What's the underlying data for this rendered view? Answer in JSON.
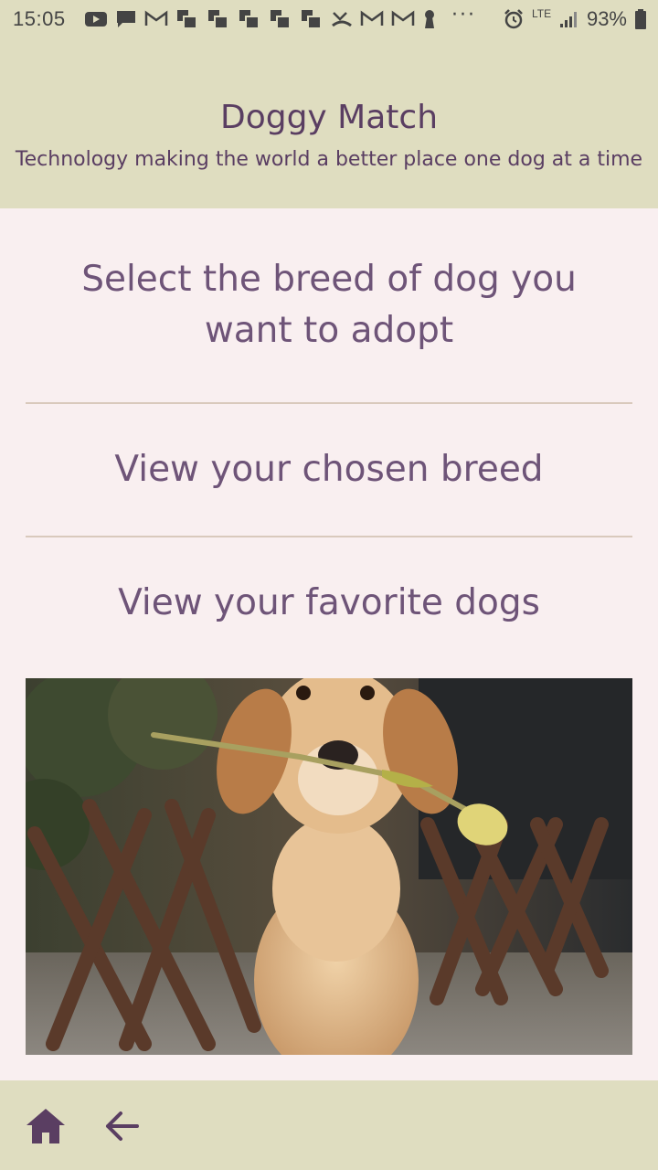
{
  "status_bar": {
    "time": "15:05",
    "network": "LTE",
    "battery": "93%"
  },
  "header": {
    "title": "Doggy Match",
    "subtitle": "Technology making the world a better place one dog at a time"
  },
  "menu": {
    "items": [
      {
        "label": "Select the breed of dog you want to adopt"
      },
      {
        "label": "View your chosen breed"
      },
      {
        "label": "View your favorite dogs"
      }
    ]
  },
  "nav": {
    "home_icon": "home-icon",
    "back_icon": "arrow-left-icon"
  },
  "colors": {
    "header_bg": "#dfddc0",
    "page_bg": "#f9eff0",
    "accent": "#5a3e62",
    "menu_text": "#6e5478",
    "divider": "#d9c9bc"
  }
}
